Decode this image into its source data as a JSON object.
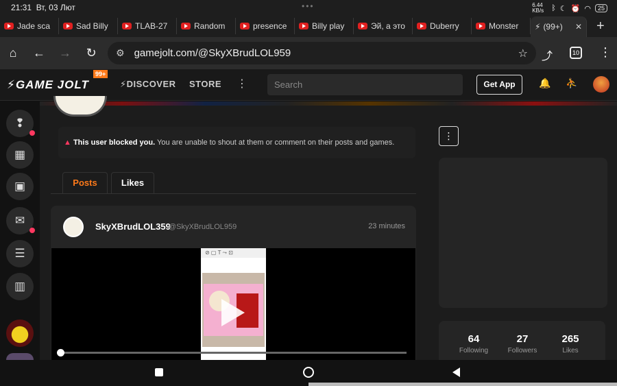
{
  "status": {
    "time": "21:31",
    "date": "Вт, 03 Лют",
    "net": "6.44 KB/s",
    "battery": "25"
  },
  "browser_tabs": [
    {
      "label": "Jade sca",
      "type": "youtube"
    },
    {
      "label": "Sad Billy",
      "type": "youtube"
    },
    {
      "label": "TLAB-27",
      "type": "youtube"
    },
    {
      "label": "Random",
      "type": "youtube"
    },
    {
      "label": "presence",
      "type": "youtube"
    },
    {
      "label": "Billy play",
      "type": "youtube"
    },
    {
      "label": "Эй, а это",
      "type": "youtube"
    },
    {
      "label": "Duberry",
      "type": "youtube"
    },
    {
      "label": "Monster",
      "type": "youtube"
    },
    {
      "label": "(99+)",
      "type": "gamejolt",
      "active": true
    }
  ],
  "address_bar": {
    "url": "gamejolt.com/@SkyXBrudLOL959",
    "tab_count": "10"
  },
  "site_nav": {
    "logo": "GAME JOLT",
    "badge": "99+",
    "discover": "DISCOVER",
    "store": "STORE",
    "search_placeholder": "Search",
    "get_app": "Get App"
  },
  "profile": {
    "blocked_title": "This user blocked you.",
    "blocked_text": "You are unable to shout at them or comment on their posts and games.",
    "tabs": [
      {
        "label": "Posts",
        "active": true
      },
      {
        "label": "Likes",
        "active": false
      }
    ]
  },
  "post": {
    "author": "SkyXBrudLOL359",
    "handle": "@SkyXBrudLOL959",
    "time": "23 minutes",
    "video_progress": 0.0
  },
  "stats": [
    {
      "value": "64",
      "label": "Following"
    },
    {
      "value": "27",
      "label": "Followers"
    },
    {
      "value": "265",
      "label": "Likes"
    }
  ],
  "colors": {
    "accent": "#ff7a1a",
    "alert": "#ff3860",
    "background": "#1c1c1c"
  }
}
